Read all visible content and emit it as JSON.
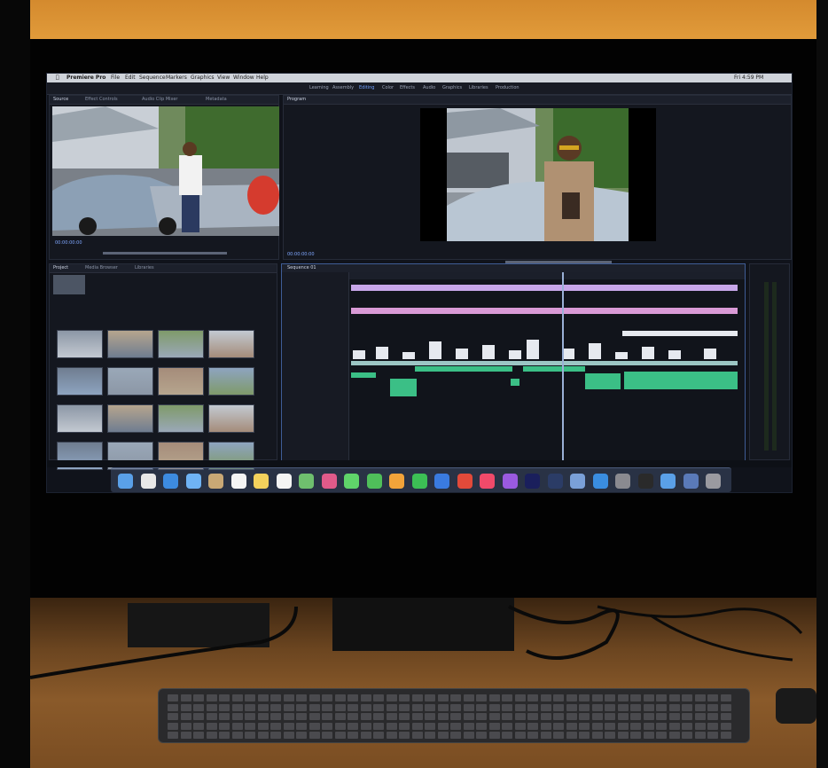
{
  "scene": {
    "description_visible": false,
    "monitor": {
      "menubar": {
        "items": [
          "Premiere Pro",
          "File",
          "Edit",
          "Sequence",
          "Markers",
          "Graphics",
          "View",
          "Window",
          "Help"
        ],
        "clock": "Fri 4:59 PM"
      },
      "workspace_tabs": [
        "Learning",
        "Assembly",
        "Editing",
        "Color",
        "Effects",
        "Audio",
        "Graphics",
        "Libraries",
        "Production"
      ],
      "source_tabs": [
        "Source",
        "Effect Controls",
        "Audio Clip Mixer",
        "Metadata"
      ],
      "program_label": "Program",
      "project_tabs": [
        "Project",
        "Media Browser",
        "Libraries"
      ],
      "timeline_label": "Sequence 01",
      "src_timecode": "00:00:00:00",
      "prog_timecode": "00:00:00:00",
      "colors": {
        "timeline_violet": "#c7a6e8",
        "timeline_pink": "#d99ad6",
        "audio_green": "#3bbf86",
        "video_white": "#e6e9ef",
        "selection_blue": "#3f5d96"
      }
    },
    "dock_icons": [
      "finder-icon",
      "launchpad-icon",
      "safari-icon",
      "mail-icon",
      "contacts-icon",
      "calendar-icon",
      "notes-icon",
      "reminders-icon",
      "maps-icon",
      "photos-icon",
      "messages-icon",
      "facetime-icon",
      "pages-icon",
      "numbers-icon",
      "keynote-icon",
      "news-blocked-icon",
      "music-icon",
      "podcasts-icon",
      "premiere-pro-icon",
      "lightroom-icon",
      "preview-icon",
      "app-store-icon",
      "system-prefs-icon",
      "quicktime-icon",
      "finder-window-icon",
      "downloads-icon",
      "trash-icon"
    ]
  }
}
